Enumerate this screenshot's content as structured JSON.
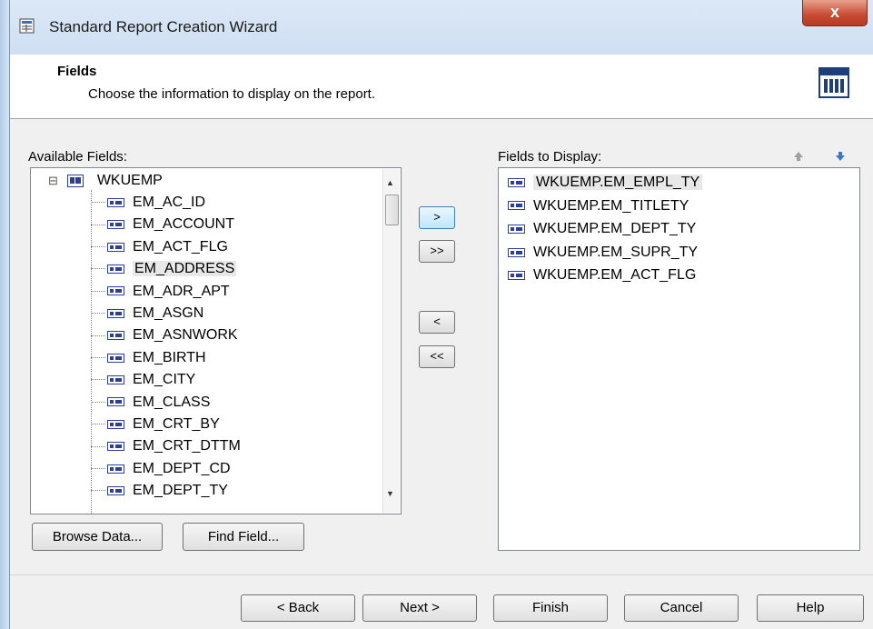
{
  "window": {
    "title": "Standard Report Creation Wizard",
    "close_glyph": "x"
  },
  "header": {
    "title": "Fields",
    "subtitle": "Choose the information to display on the report.",
    "icon": "table-report-icon"
  },
  "available": {
    "label": "Available Fields:",
    "root": "WKUEMP",
    "expander": "⊟",
    "fields": [
      "EM_AC_ID",
      "EM_ACCOUNT",
      "EM_ACT_FLG",
      "EM_ADDRESS",
      "EM_ADR_APT",
      "EM_ASGN",
      "EM_ASNWORK",
      "EM_BIRTH",
      "EM_CITY",
      "EM_CLASS",
      "EM_CRT_BY",
      "EM_CRT_DTTM",
      "EM_DEPT_CD",
      "EM_DEPT_TY"
    ],
    "selected_index": 3
  },
  "display": {
    "label": "Fields to Display:",
    "fields": [
      "WKUEMP.EM_EMPL_TY",
      "WKUEMP.EM_TITLETY",
      "WKUEMP.EM_DEPT_TY",
      "WKUEMP.EM_SUPR_TY",
      "WKUEMP.EM_ACT_FLG"
    ],
    "selected_index": 0
  },
  "move_buttons": {
    "add": ">",
    "add_all": ">>",
    "remove": "<",
    "remove_all": "<<"
  },
  "left_buttons": {
    "browse": "Browse Data...",
    "find": "Find Field..."
  },
  "footer": {
    "back": "< Back",
    "next": "Next >",
    "finish": "Finish",
    "cancel": "Cancel",
    "help": "Help"
  },
  "colors": {
    "accent": "#3c7fb1",
    "close": "#c74a32",
    "field_icon": "#2b3f9a",
    "arrow_up": "#a0a0a0",
    "arrow_down": "#3a78c8"
  }
}
